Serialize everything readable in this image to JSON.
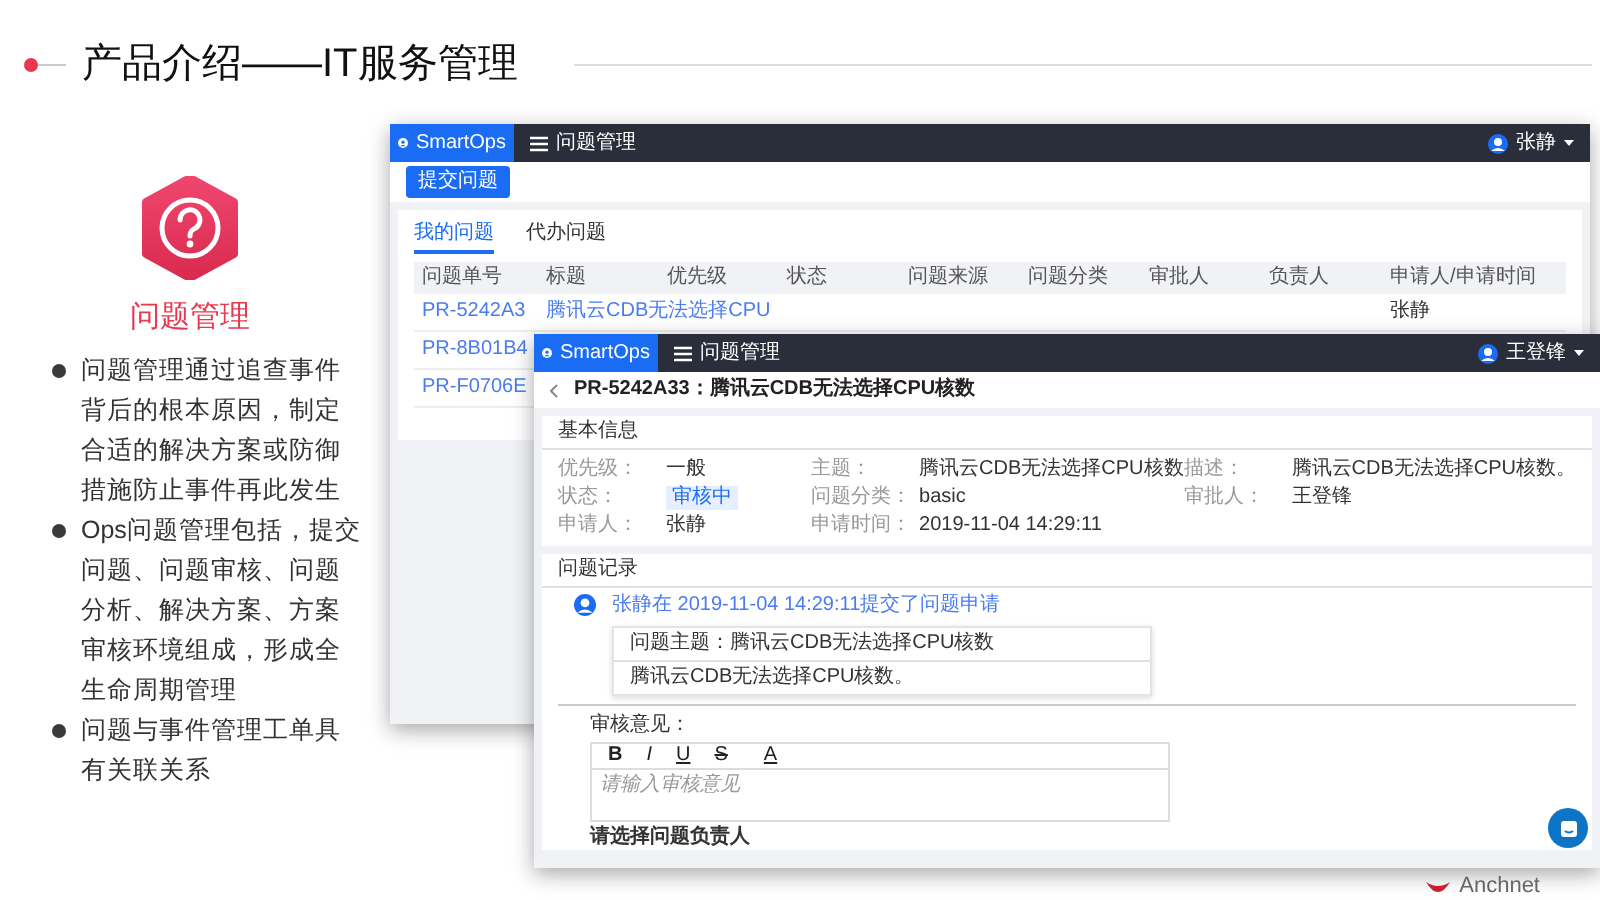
{
  "slide": {
    "title": "产品介绍——IT服务管理"
  },
  "feature": {
    "title": "问题管理",
    "bullets": [
      "问题管理通过追查事件背后的根本原因，制定合适的解决方案或防御措施防止事件再此发生",
      "Ops问题管理包括，提交问题、问题审核、问题分析、解决方案、方案审核环境组成，形成全生命周期管理",
      "问题与事件管理工单具有关联关系"
    ]
  },
  "back_window": {
    "brand": "SmartOps",
    "module": "问题管理",
    "user": "张静",
    "submit_button": "提交问题",
    "tabs": [
      {
        "label": "我的问题",
        "selected": true
      },
      {
        "label": "代办问题",
        "selected": false
      }
    ],
    "columns": [
      "问题单号",
      "标题",
      "优先级",
      "状态",
      "问题来源",
      "问题分类",
      "审批人",
      "负责人",
      "申请人/申请时间"
    ],
    "rows": [
      {
        "id": "PR-5242A3",
        "title": "腾讯云CDB无法选择CPU",
        "applicant": "张静"
      },
      {
        "id": "PR-8B01B4"
      },
      {
        "id": "PR-F0706E"
      }
    ]
  },
  "front_window": {
    "brand": "SmartOps",
    "module": "问题管理",
    "user": "王登锋",
    "page_title": "PR-5242A33：腾讯云CDB无法选择CPU核数",
    "basic_info": {
      "title": "基本信息",
      "fields": [
        {
          "label": "优先级：",
          "value": "一般",
          "kind": "text"
        },
        {
          "label": "主题：",
          "value": "腾讯云CDB无法选择CPU核数",
          "kind": "text"
        },
        {
          "label": "描述：",
          "value": "腾讯云CDB无法选择CPU核数。",
          "kind": "text"
        },
        {
          "label": "状态：",
          "value": "审核中",
          "kind": "tag"
        },
        {
          "label": "问题分类：",
          "value": "basic",
          "kind": "text"
        },
        {
          "label": "审批人：",
          "value": "王登锋",
          "kind": "text"
        },
        {
          "label": "申请人：",
          "value": "张静",
          "kind": "text"
        },
        {
          "label": "申请时间：",
          "value": "2019-11-04 14:29:11",
          "kind": "text"
        }
      ]
    },
    "record": {
      "title": "问题记录",
      "entry": {
        "line": "张静在 2019-11-04 14:29:11提交了问题申请",
        "subject": "问题主题：腾讯云CDB无法选择CPU核数",
        "body": "腾讯云CDB无法选择CPU核数。"
      },
      "review_label": "审核意见：",
      "toolbar": [
        {
          "label": "B",
          "kind": "bold"
        },
        {
          "label": "I",
          "kind": "italic"
        },
        {
          "label": "U",
          "kind": "underline"
        },
        {
          "label": "S",
          "kind": "strike"
        },
        {
          "label": "A",
          "kind": "color"
        }
      ],
      "placeholder": "请输入审核意见",
      "assignee_label": "请选择问题负责人"
    }
  },
  "logo": {
    "text": "Anchnet"
  }
}
